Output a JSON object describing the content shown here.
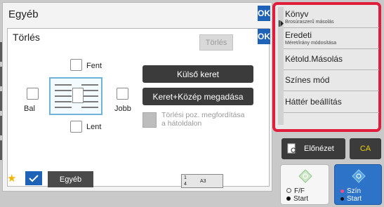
{
  "outer": {
    "title": "Egyéb",
    "ok": "OK"
  },
  "inner": {
    "title": "Törlés",
    "ok": "OK",
    "button": "Törlés"
  },
  "positions": {
    "top": "Fent",
    "left": "Bal",
    "right": "Jobb",
    "bottom": "Lent"
  },
  "actions": {
    "outer_frame": "Külső keret",
    "frame_center": "Keret+Közép megadása"
  },
  "flip": {
    "line1": "Törlési poz. megfordítása",
    "line2": "a hátoldalon"
  },
  "right_panel": {
    "items": [
      {
        "label": "Könyv",
        "sub": "Brosúraszerű másolás"
      },
      {
        "label": "Eredeti",
        "sub": "Méret/irány módosítása"
      },
      {
        "label": "Kétold.Másolás"
      },
      {
        "label": "Színes mód"
      },
      {
        "label": "Háttér beállítás"
      }
    ]
  },
  "bottom": {
    "preview": "Előnézet",
    "ca": "CA",
    "ff_start": {
      "line1": "F/F",
      "line2": "Start"
    },
    "color_start": {
      "line1": "Szín",
      "line2": "Start"
    },
    "egyeb_tab": "Egyéb",
    "minimap": {
      "num1": "1",
      "num4": "4",
      "size": "A3"
    }
  },
  "colors": {
    "accent": "#1f63b8",
    "highlight": "#e01e3c",
    "start_blue": "#2d73c8",
    "ca_text": "#f0d000"
  }
}
